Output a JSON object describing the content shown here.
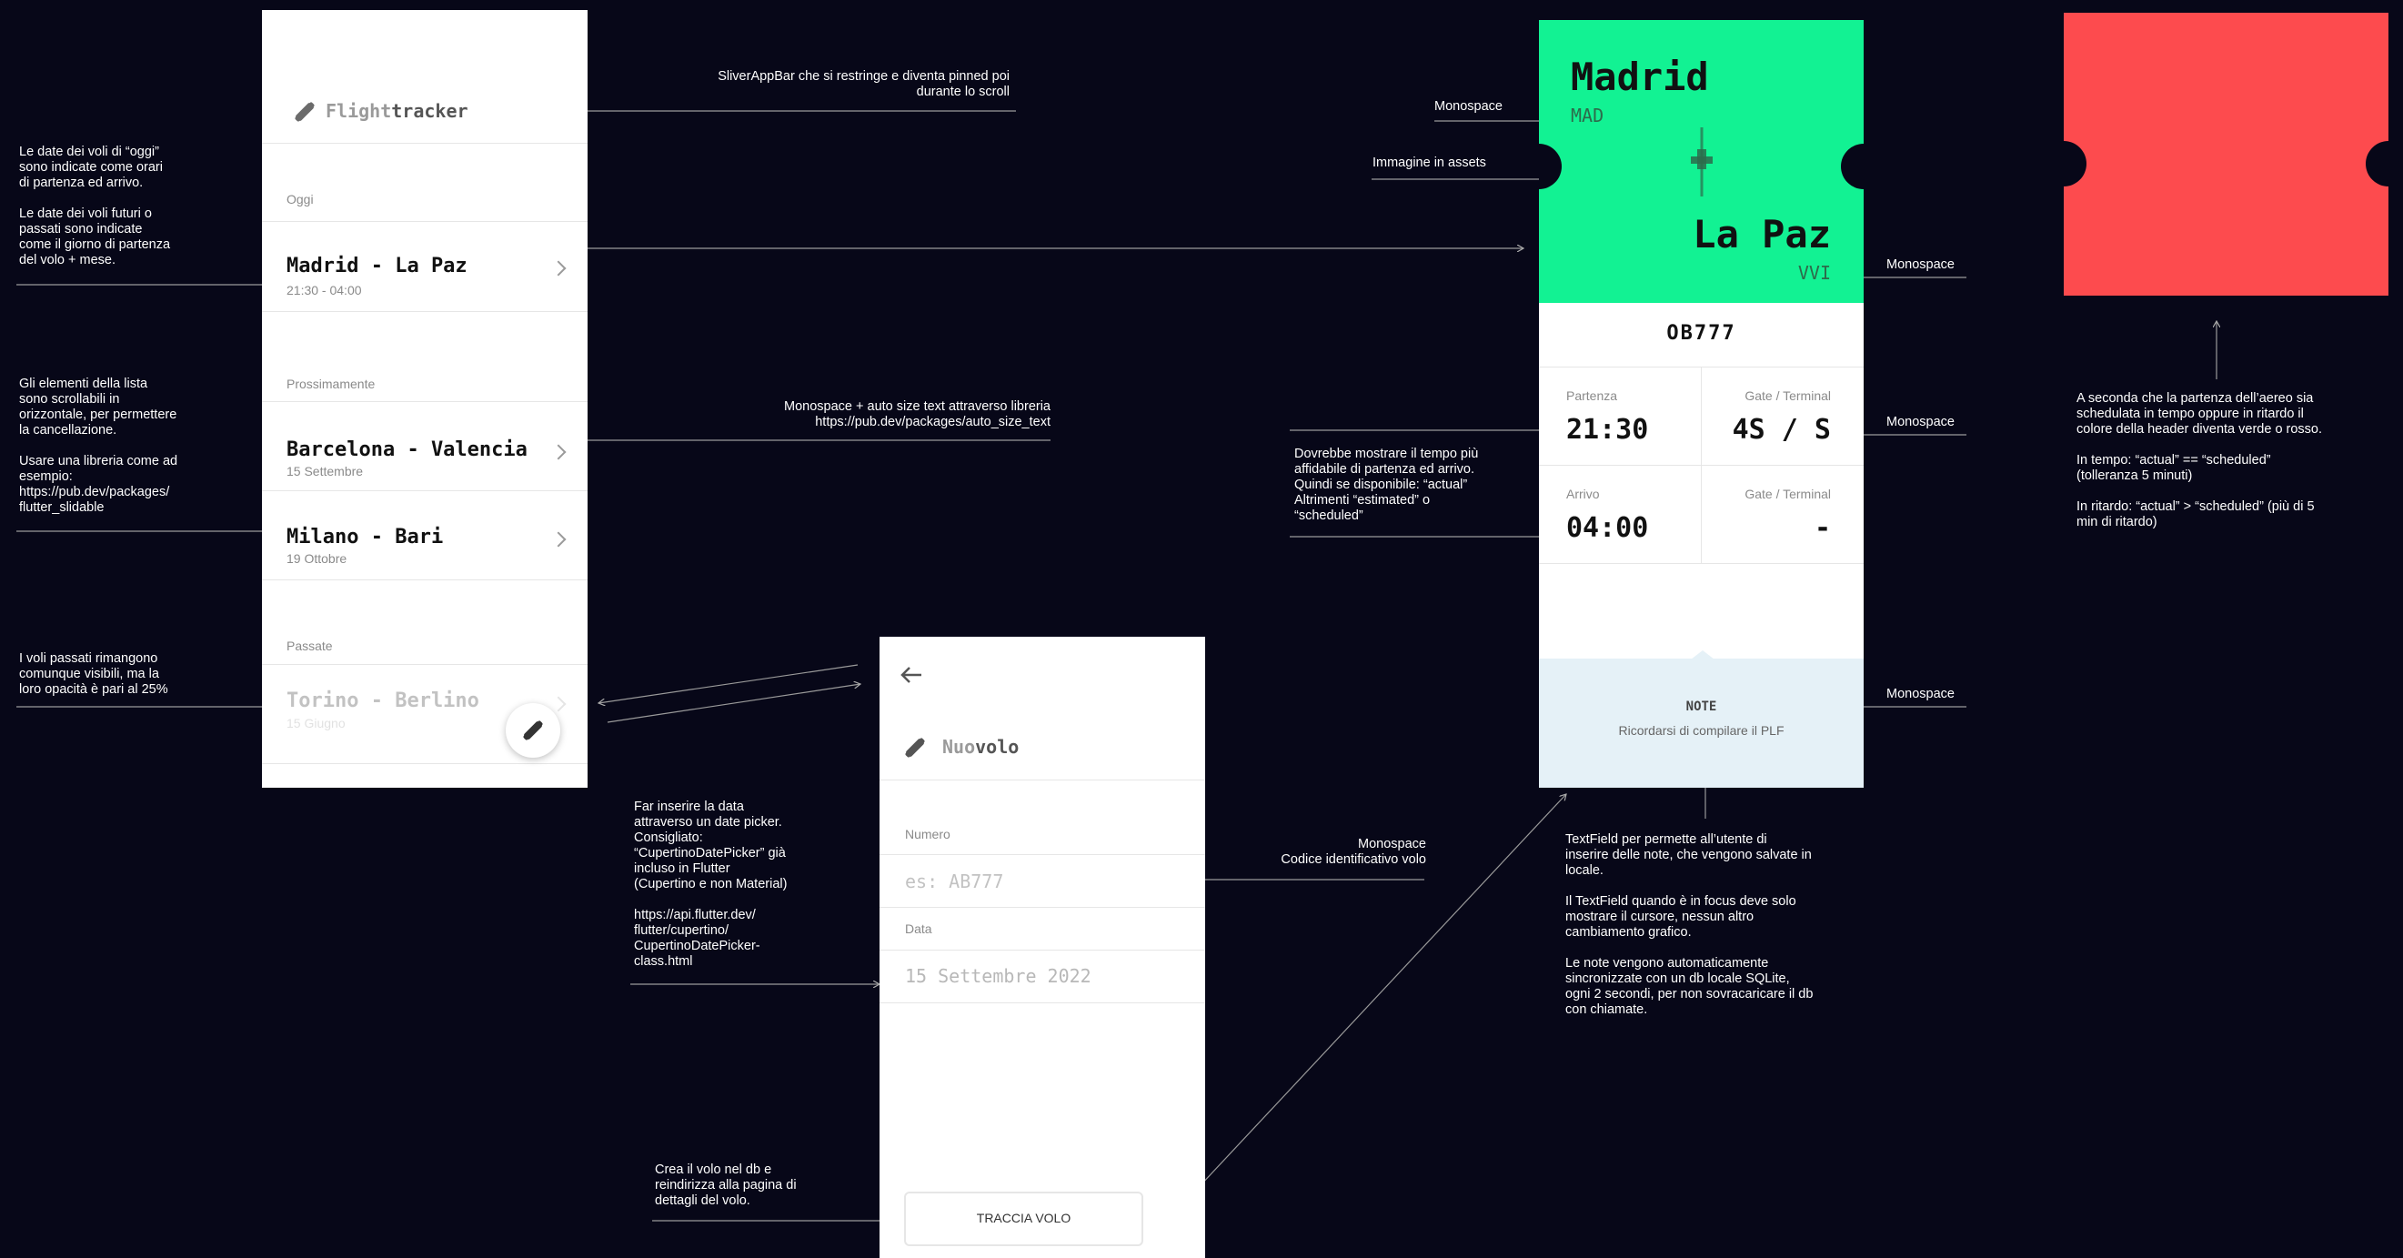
{
  "list_screen": {
    "brand_first": "Flight",
    "brand_second": "tracker",
    "sections": [
      {
        "title": "Oggi",
        "items": [
          {
            "route": "Madrid - La Paz",
            "sub": "21:30 - 04:00"
          }
        ]
      },
      {
        "title": "Prossimamente",
        "items": [
          {
            "route": "Barcelona - Valencia",
            "sub": "15 Settembre"
          },
          {
            "route": "Milano - Bari",
            "sub": "19 Ottobre"
          }
        ]
      },
      {
        "title": "Passate",
        "items": [
          {
            "route": "Torino - Berlino",
            "sub": "15 Giugno"
          }
        ]
      }
    ]
  },
  "new_screen": {
    "brand_first": "Nuo",
    "brand_second": "volo",
    "number_label": "Numero",
    "number_placeholder": "es: AB777",
    "date_label": "Data",
    "date_value": "15 Settembre 2022",
    "button_label": "TRACCIA VOLO"
  },
  "detail_screen": {
    "from_city": "Madrid",
    "from_code": "MAD",
    "to_city": "La Paz",
    "to_code": "VVI",
    "flight_number": "OB777",
    "departure_label": "Partenza",
    "departure_time": "21:30",
    "gate_label": "Gate / Terminal",
    "departure_gate": "4S / S",
    "arrival_label": "Arrivo",
    "arrival_time": "04:00",
    "arrival_gate": "-",
    "notes_title": "NOTE",
    "notes_text": "Ricordarsi di compilare il PLF"
  },
  "colors": {
    "on_time": "#12f293",
    "delayed": "#fd4b4e",
    "notes_bg": "#e5f1f7",
    "background": "#070718"
  },
  "annotations": {
    "sliver": "SliverAppBar che si restringe e diventa pinned poi\ndurante lo scroll",
    "dates": "Le date dei voli di “oggi”\nsono indicate come orari\ndi partenza ed arrivo.\n\nLe date dei voli futuri o\npassati sono indicate\ncome il giorno di partenza\ndel volo + mese.",
    "slidable": "Gli elementi della lista\nsono scrollabili in\norizzontale, per permettere\nla cancellazione.\n\nUsare una libreria come ad\nesempio:\nhttps://pub.dev/packages/\nflutter_slidable",
    "past": "I voli passati rimangono\ncomunque visibili, ma la\nloro opacità è pari al 25%",
    "autosize": "Monospace + auto size text attraverso libreria\nhttps://pub.dev/packages/auto_size_text",
    "datepicker": "Far inserire la data\nattraverso un date picker.\nConsigliato:\n“CupertinoDatePicker” già\nincluso in Flutter\n(Cupertino e non Material)\n\nhttps://api.flutter.dev/\nflutter/cupertino/\nCupertinoDatePicker-\nclass.html",
    "monospace_code": "Monospace\nCodice identificativo volo",
    "create": "Crea il volo nel db e\nreindirizza alla pagina di\ndettagli del volo.",
    "monospace_1": "Monospace",
    "assets": "Immagine in assets",
    "times": "Dovrebbe mostrare il tempo più\naffidabile di partenza ed arrivo.\nQuindi se disponibile: “actual”\nAltrimenti “estimated” o\n“scheduled”",
    "monospace_2": "Monospace",
    "monospace_3": "Monospace",
    "monospace_4": "Monospace",
    "textfield": "TextField per permette all’utente di\ninserire delle note, che vengono salvate in\nlocale.\n\nIl TextField quando è in focus deve solo\nmostrare il cursore, nessun altro\ncambiamento grafico.\n\nLe note vengono automaticamente\nsincronizzate con un db locale SQLite,\nogni 2 secondi, per non sovracaricare il db\ncon chiamate.",
    "header_color": "A seconda che la partenza dell’aereo sia\nschedulata in tempo oppure in ritardo il\ncolore della header diventa verde o rosso.\n\nIn tempo: “actual” == “scheduled”\n(tolleranza 5 minuti)\n\nIn ritardo: “actual” > “scheduled” (più di 5\nmin di ritardo)"
  }
}
